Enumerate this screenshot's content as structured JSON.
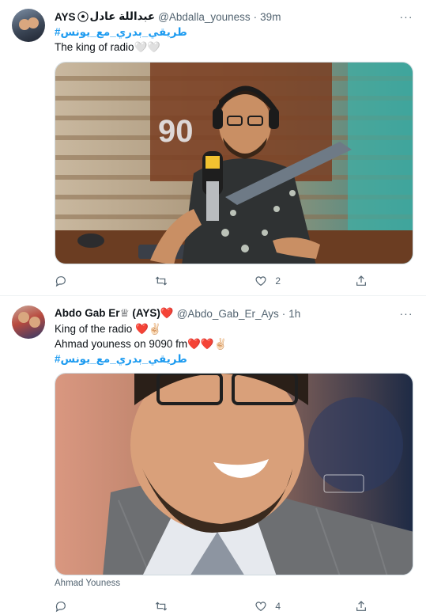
{
  "tweets": [
    {
      "display_name": "AYS",
      "name_suffix": "عبداللة عادل",
      "handle": "@Abdalla_youness",
      "dot": "·",
      "time": "39m",
      "hashtag": "#طريقي_بدري_مع_يونس",
      "text_lines": [
        "The king of radio🤍🤍"
      ],
      "media_caption": "",
      "reply_count": "",
      "retweet_count": "",
      "like_count": "2",
      "more_glyph": "···"
    },
    {
      "display_name": "Abdo Gab Er♕ (AYS)❤️",
      "handle": "@Abdo_Gab_Er_Ays",
      "dot": "·",
      "time": "1h",
      "text_lines": [
        "King of the radio ❤️✌🏻",
        "Ahmad youness on 9090 fm❤️❤️✌🏻"
      ],
      "hashtag": "#طريقي_بدري_مع_يونس",
      "media_caption": "Ahmad Youness",
      "reply_count": "",
      "retweet_count": "",
      "like_count": "4",
      "more_glyph": "···"
    }
  ],
  "colors": {
    "link": "#1d9bf0",
    "secondary_text": "#536471",
    "divider": "#eff3f4"
  },
  "icons": [
    "reply-icon",
    "retweet-icon",
    "like-icon",
    "share-icon",
    "more-icon",
    "football-icon"
  ]
}
